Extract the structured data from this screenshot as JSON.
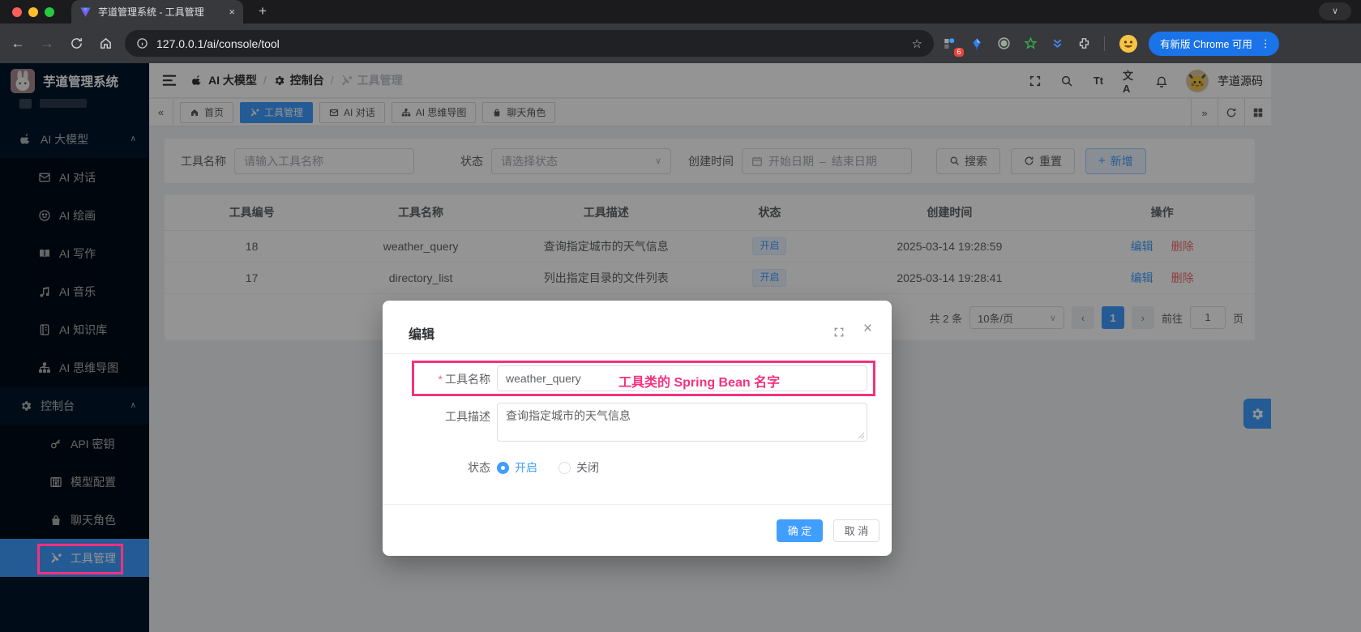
{
  "glyphs": {
    "back": "←",
    "forward": "→",
    "star": "☆",
    "kebab": "⋮",
    "close": "×",
    "plus": "+",
    "chevron_down": "∨",
    "chevron_up": "∧",
    "collapse": "«",
    "expand": "»",
    "prev": "‹",
    "next": "›",
    "slash": "/",
    "dash": "–",
    "asterisk": "*",
    "font_size": "Tt",
    "translate": "文A"
  },
  "colors": {
    "primary": "#409eff",
    "danger": "#f56c6c",
    "annotation_pink": "#f5317f",
    "sidebar_bg": "#001529",
    "chrome_update_blue": "#1a73e8",
    "tag_blue_bg": "#ecf5ff"
  },
  "browser": {
    "tab_title": "芋道管理系统 - 工具管理",
    "url": "127.0.0.1/ai/console/tool",
    "extension_badge": "6",
    "update_button_label": "有新版 Chrome 可用"
  },
  "sidebar": {
    "logo_title": "芋道管理系统",
    "group1_label": "AI 大模型",
    "group2_label": "控制台",
    "items1": [
      "AI 对话",
      "AI 绘画",
      "AI 写作",
      "AI 音乐",
      "AI 知识库",
      "AI 思维导图"
    ],
    "items2": [
      "API 密钥",
      "模型配置",
      "聊天角色",
      "工具管理"
    ]
  },
  "breadcrumb": {
    "item1": "AI 大模型",
    "item2": "控制台",
    "item3": "工具管理"
  },
  "header": {
    "username": "芋道源码"
  },
  "tabs": {
    "items": [
      "首页",
      "工具管理",
      "AI 对话",
      "AI 思维导图",
      "聊天角色"
    ]
  },
  "filter": {
    "name_label": "工具名称",
    "name_placeholder": "请输入工具名称",
    "status_label": "状态",
    "status_placeholder": "请选择状态",
    "time_label": "创建时间",
    "start_placeholder": "开始日期",
    "end_placeholder": "结束日期",
    "search_label": "搜索",
    "reset_label": "重置",
    "add_label": "新增"
  },
  "table": {
    "headers": [
      "工具编号",
      "工具名称",
      "工具描述",
      "状态",
      "创建时间",
      "操作"
    ],
    "actions": {
      "edit": "编辑",
      "delete": "删除"
    },
    "rows": [
      {
        "id": "18",
        "name": "weather_query",
        "desc": "查询指定城市的天气信息",
        "status": "开启",
        "created": "2025-03-14 19:28:59"
      },
      {
        "id": "17",
        "name": "directory_list",
        "desc": "列出指定目录的文件列表",
        "status": "开启",
        "created": "2025-03-14 19:28:41"
      }
    ]
  },
  "pagination": {
    "total": "共 2 条",
    "page_size": "10条/页",
    "page": "1",
    "goto_label": "前往",
    "goto_value": "1",
    "goto_unit": "页"
  },
  "modal": {
    "title": "编辑",
    "name_label": "工具名称",
    "name_value": "weather_query",
    "name_annotation": "工具类的 Spring Bean 名字",
    "desc_label": "工具描述",
    "desc_value": "查询指定城市的天气信息",
    "status_label": "状态",
    "status_on": "开启",
    "status_off": "关闭",
    "confirm_label": "确 定",
    "cancel_label": "取 消"
  }
}
